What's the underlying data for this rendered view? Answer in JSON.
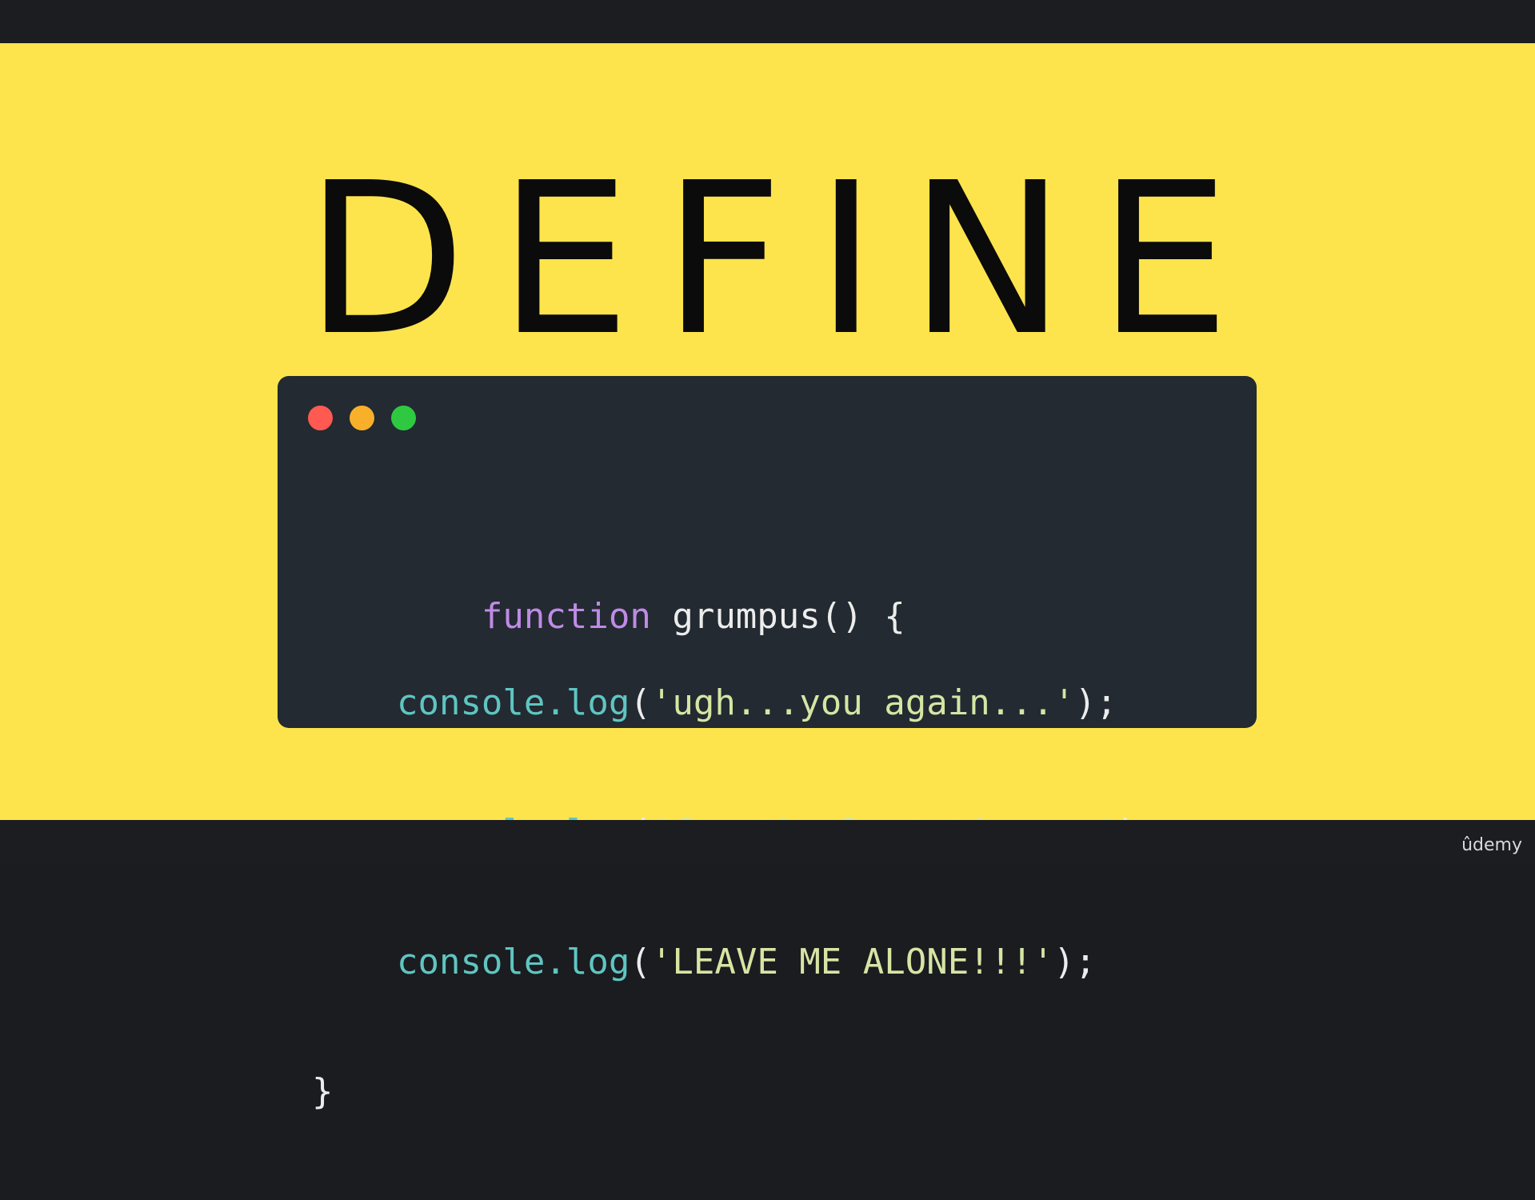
{
  "slide": {
    "title": "DEFINE",
    "background_color": "#fde44c"
  },
  "code_window": {
    "background_color": "#232a31",
    "window_controls": [
      "close",
      "minimize",
      "zoom"
    ],
    "lines": [
      {
        "indent": "",
        "parts": [
          {
            "type": "keyword",
            "text": "function"
          },
          {
            "type": "plain",
            "text": " grumpus() {"
          }
        ]
      },
      {
        "indent": "    ",
        "parts": [
          {
            "type": "object",
            "text": "console.log"
          },
          {
            "type": "plain",
            "text": "("
          },
          {
            "type": "string",
            "text": "'ugh...you again...'"
          },
          {
            "type": "plain",
            "text": ");"
          }
        ]
      },
      {
        "indent": "    ",
        "parts": [
          {
            "type": "object",
            "text": "console.log"
          },
          {
            "type": "plain",
            "text": "("
          },
          {
            "type": "string",
            "text": "'for the last time...'"
          },
          {
            "type": "plain",
            "text": ");"
          }
        ]
      },
      {
        "indent": "    ",
        "parts": [
          {
            "type": "object",
            "text": "console.log"
          },
          {
            "type": "plain",
            "text": "("
          },
          {
            "type": "string",
            "text": "'LEAVE ME ALONE!!!'"
          },
          {
            "type": "plain",
            "text": ");"
          }
        ]
      },
      {
        "indent": "",
        "parts": [
          {
            "type": "plain",
            "text": "}"
          }
        ]
      }
    ]
  },
  "watermark": {
    "brand": "ûdemy"
  }
}
